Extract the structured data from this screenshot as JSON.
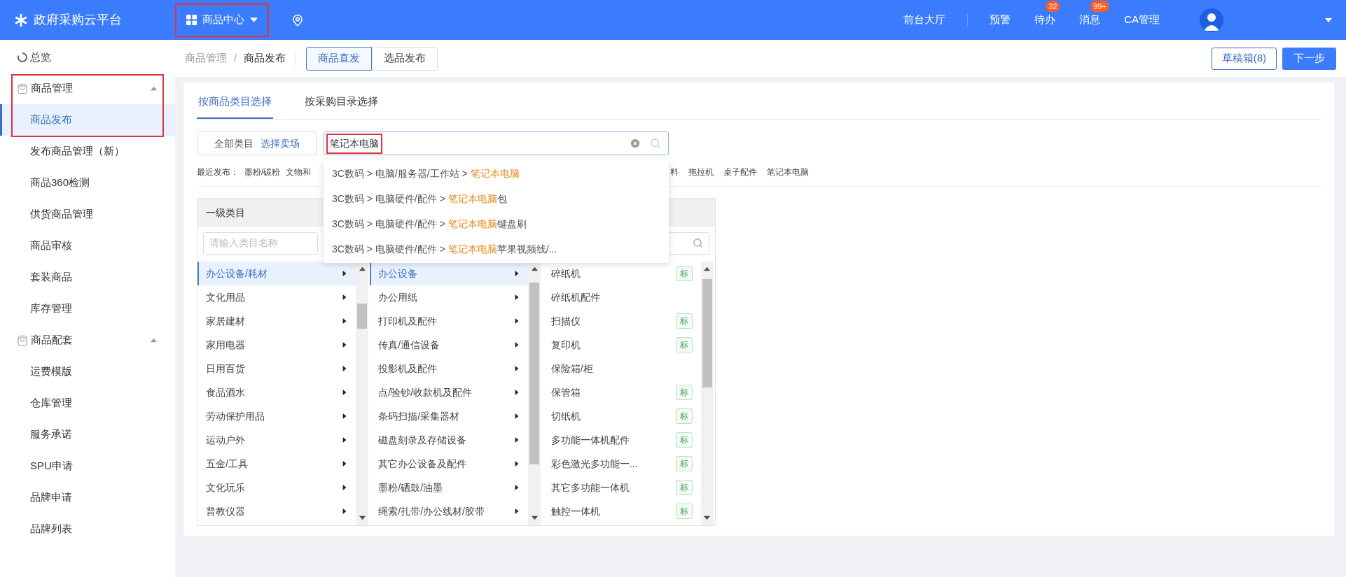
{
  "header": {
    "logo": "政府采购云平台",
    "module_menu": {
      "label": "商品中心",
      "annotated": true
    },
    "nav": [
      {
        "label": "前台大厅"
      },
      {
        "label": "预警"
      },
      {
        "label": "待办",
        "badge": "32"
      },
      {
        "label": "消息",
        "badge": "99+"
      },
      {
        "label": "CA管理"
      }
    ]
  },
  "sidebar": {
    "items": [
      {
        "kind": "link",
        "label": "总览"
      },
      {
        "kind": "group",
        "label": "商品管理",
        "expanded": true,
        "annotated": true,
        "children": [
          {
            "label": "商品发布",
            "selected": true
          },
          {
            "label": "发布商品管理（新）",
            "selected": false
          },
          {
            "label": "商品360检测",
            "selected": false
          },
          {
            "label": "供货商品管理",
            "selected": false
          },
          {
            "label": "商品审核",
            "selected": false
          },
          {
            "label": "套装商品",
            "selected": false
          },
          {
            "label": "库存管理",
            "selected": false
          }
        ]
      },
      {
        "kind": "group",
        "label": "商品配套",
        "expanded": true,
        "annotated": false,
        "children": [
          {
            "label": "运费模版",
            "selected": false
          },
          {
            "label": "仓库管理",
            "selected": false
          },
          {
            "label": "服务承诺",
            "selected": false
          },
          {
            "label": "SPU申请",
            "selected": false
          },
          {
            "label": "品牌申请",
            "selected": false
          },
          {
            "label": "品牌列表",
            "selected": false
          }
        ]
      }
    ]
  },
  "breadcrumb": {
    "items": [
      "商品管理",
      "商品发布"
    ],
    "separator": "/"
  },
  "mode_tabs": [
    {
      "label": "商品直发",
      "selected": true
    },
    {
      "label": "选品发布",
      "selected": false
    }
  ],
  "actions": {
    "drafts": "草稿箱(8)",
    "next": "下一步"
  },
  "tabs": [
    {
      "label": "按商品类目选择",
      "selected": true
    },
    {
      "label": "按采购目录选择",
      "selected": false
    }
  ],
  "scope": {
    "label": "全部类目",
    "link": "选择卖场"
  },
  "search": {
    "value": "笔记本电脑",
    "annotated": true
  },
  "suggestions": [
    {
      "prefix": "3C数码 > 电脑/服务器/工作站 > ",
      "match": "笔记本电脑"
    },
    {
      "prefix": "3C数码 > 电脑硬件/配件 > ",
      "match": "笔记本电脑",
      "suffix": "包"
    },
    {
      "prefix": "3C数码 > 电脑硬件/配件 > ",
      "match": "笔记本电脑",
      "suffix": "键盘刷"
    },
    {
      "prefix": "3C数码 > 电脑硬件/配件 > ",
      "match": "笔记本电脑",
      "suffix": "苹果视频线/..."
    }
  ],
  "recent": {
    "label": "最近发布：",
    "items_before": [
      "墨粉/碳粉",
      "文物和"
    ],
    "items_after": [
      "料",
      "拖拉机",
      "桌子配件",
      "笔记本电脑"
    ]
  },
  "categories": {
    "header": "一级类目",
    "filter_placeholder": "请输入类目名称",
    "level1": [
      {
        "label": "办公设备/耗材",
        "selected": true
      },
      {
        "label": "文化用品",
        "selected": false
      },
      {
        "label": "家居建材",
        "selected": false
      },
      {
        "label": "家用电器",
        "selected": false
      },
      {
        "label": "日用百货",
        "selected": false
      },
      {
        "label": "食品酒水",
        "selected": false
      },
      {
        "label": "劳动保护用品",
        "selected": false
      },
      {
        "label": "运动户外",
        "selected": false
      },
      {
        "label": "五金/工具",
        "selected": false
      },
      {
        "label": "文化玩乐",
        "selected": false
      },
      {
        "label": "普教仪器",
        "selected": false
      }
    ],
    "level2": [
      {
        "label": "办公设备",
        "selected": true
      },
      {
        "label": "办公用纸",
        "selected": false
      },
      {
        "label": "打印机及配件",
        "selected": false
      },
      {
        "label": "传真/通信设备",
        "selected": false
      },
      {
        "label": "投影机及配件",
        "selected": false
      },
      {
        "label": "点/验钞/收款机及配件",
        "selected": false
      },
      {
        "label": "条码扫描/采集器材",
        "selected": false
      },
      {
        "label": "磁盘刻录及存储设备",
        "selected": false
      },
      {
        "label": "其它办公设备及配件",
        "selected": false
      },
      {
        "label": "墨粉/硒鼓/油墨",
        "selected": false
      },
      {
        "label": "绳索/扎带/办公线材/胶带",
        "selected": false
      }
    ],
    "level3": [
      {
        "label": "碎纸机",
        "tag": "标"
      },
      {
        "label": "碎纸机配件"
      },
      {
        "label": "扫描仪",
        "tag": "标"
      },
      {
        "label": "复印机",
        "tag": "标"
      },
      {
        "label": "保险箱/柜"
      },
      {
        "label": "保管箱",
        "tag": "标"
      },
      {
        "label": "切纸机",
        "tag": "标"
      },
      {
        "label": "多功能一体机配件",
        "tag": "标"
      },
      {
        "label": "彩色激光多功能一...",
        "tag": "标"
      },
      {
        "label": "其它多功能一体机",
        "tag": "标"
      },
      {
        "label": "触控一体机",
        "tag": "标"
      }
    ]
  }
}
